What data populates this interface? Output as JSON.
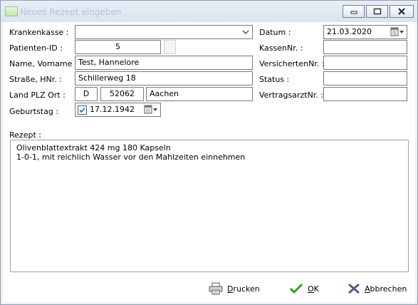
{
  "window": {
    "title": "Neues Rezept eingeben"
  },
  "form": {
    "krankenkasse": {
      "label": "Krankenkasse :",
      "value": ""
    },
    "patienten_id": {
      "label": "Patienten-ID :",
      "value": "5"
    },
    "name": {
      "label": "Name, Vorname :",
      "value": "Test, Hannelore"
    },
    "strasse": {
      "label": "Straße, HNr. :",
      "value": "Schillerweg 18"
    },
    "ort": {
      "label": "Land PLZ Ort :",
      "land": "D",
      "plz": "52062",
      "ort": "Aachen"
    },
    "geburtstag": {
      "label": "Geburtstag :",
      "value": "17.12.1942"
    },
    "datum": {
      "label": "Datum :",
      "value": "21.03.2020"
    },
    "kassennr": {
      "label": "KassenNr. :",
      "value": ""
    },
    "versichertennr": {
      "label": "VersichertenNr. :",
      "value": ""
    },
    "status": {
      "label": "Status :",
      "value": ""
    },
    "vertragsarztnr": {
      "label": "VertragsarztNr. :",
      "value": ""
    },
    "rezept": {
      "label": "Rezept :",
      "lines": [
        "Olivenblattextrakt 424 mg 180 Kapseln",
        "1-0-1, mit reichlich Wasser vor den Mahlzeiten einnehmen"
      ]
    }
  },
  "buttons": {
    "drucken_first": "D",
    "drucken_rest": "rucken",
    "ok_first": "O",
    "ok_rest": "K",
    "abbrechen_first": "A",
    "abbrechen_rest": "bbrechen"
  },
  "icons": [
    "app-icon",
    "minimize-icon",
    "maximize-icon",
    "close-icon",
    "chevron-down-icon",
    "calendar-icon",
    "printer-icon",
    "check-icon",
    "cross-icon"
  ]
}
